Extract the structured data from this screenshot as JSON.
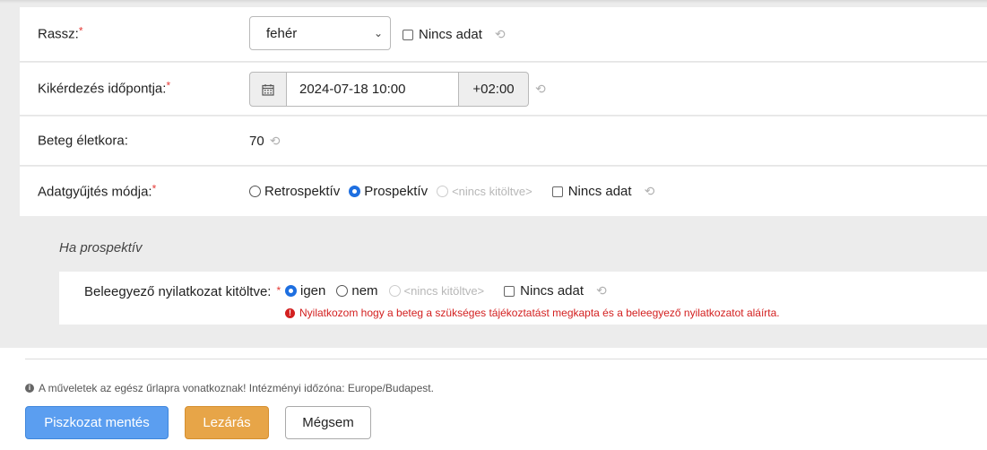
{
  "rows": {
    "race": {
      "label": "Rassz:",
      "required": "*",
      "select_value": "fehér",
      "no_data_label": "Nincs adat"
    },
    "interview_time": {
      "label": "Kikérdezés időpontja:",
      "required": "*",
      "datetime_value": "2024-07-18 10:00",
      "timezone": "+02:00"
    },
    "age": {
      "label": "Beteg életkora:",
      "value": "70"
    },
    "collection_mode": {
      "label": "Adatgyűjtés módja:",
      "required": "*",
      "options": [
        "Retrospektív",
        "Prospektív",
        "<nincs kitöltve>"
      ],
      "selected": "Prospektív",
      "no_data_label": "Nincs adat"
    }
  },
  "prospective_section": {
    "heading": "Ha prospektív",
    "consent": {
      "label": "Beleegyező nyilatkozat kitöltve:",
      "required": "*",
      "options": [
        "igen",
        "nem",
        "<nincs kitöltve>"
      ],
      "selected": "igen",
      "no_data_label": "Nincs adat",
      "error_text": "Nyilatkozom hogy a beteg a szükséges tájékoztatást megkapta és a beleegyező nyilatkozatot aláírta."
    }
  },
  "footer": {
    "info_text": "A műveletek az egész űrlapra vonatkoznak! Intézményi időzóna: Europe/Budapest.",
    "buttons": {
      "draft_save": "Piszkozat mentés",
      "close": "Lezárás",
      "cancel": "Mégsem"
    }
  },
  "icons": {
    "history": "history-icon",
    "calendar": "calendar-icon",
    "error": "error-circle-icon",
    "info": "info-circle-icon"
  },
  "colors": {
    "required_star": "#e53935",
    "error_text": "#d32020",
    "primary_button": "#5b9ef0",
    "warning_button": "#e7a548",
    "radio_selected": "#1e6fe0"
  }
}
